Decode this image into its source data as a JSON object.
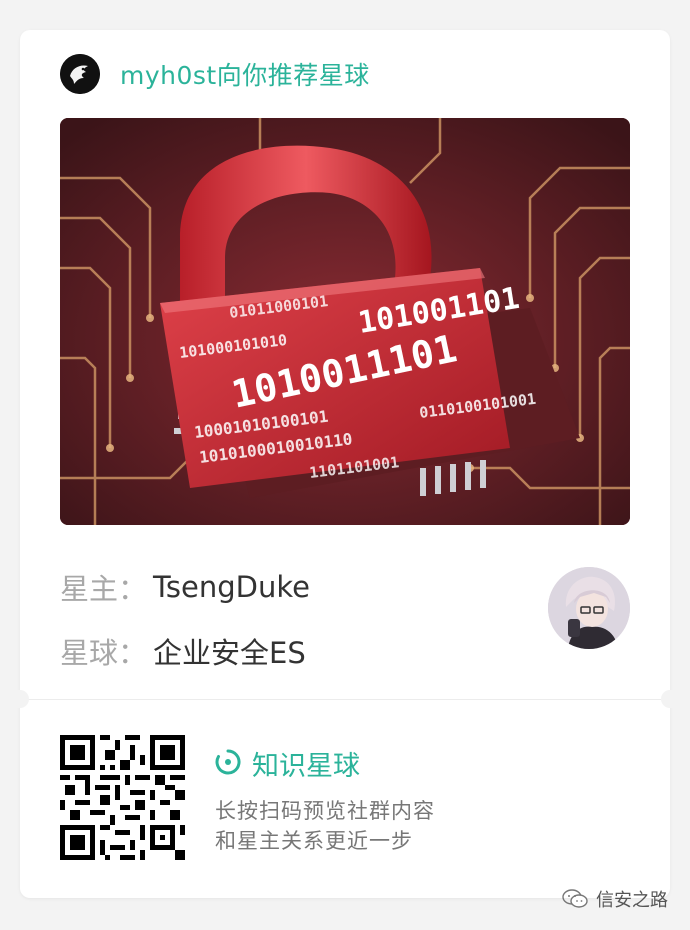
{
  "header": {
    "title": "myh0st向你推荐星球",
    "logo_icon": "dragon-logo-icon"
  },
  "hero": {
    "image_icon": "red-padlock-circuit-image",
    "binary_lines": [
      "1010011101",
      "101001101",
      "10001010100101",
      "1010100010010110",
      "0110100101001",
      "1101101001",
      "101000101010",
      "01011000101"
    ]
  },
  "owner": {
    "label": "星主：",
    "name": "TsengDuke"
  },
  "planet": {
    "label": "星球：",
    "name": "企业安全ES"
  },
  "footer": {
    "brand": "知识星球",
    "desc_line1": "长按扫码预览社群内容",
    "desc_line2": "和星主关系更近一步",
    "qr_icon": "qr-code-icon"
  },
  "watermark": {
    "text": "信安之路",
    "icon": "wechat-icon"
  },
  "colors": {
    "accent": "#2bb39a",
    "background": "#f3f3f3",
    "card": "#ffffff"
  }
}
